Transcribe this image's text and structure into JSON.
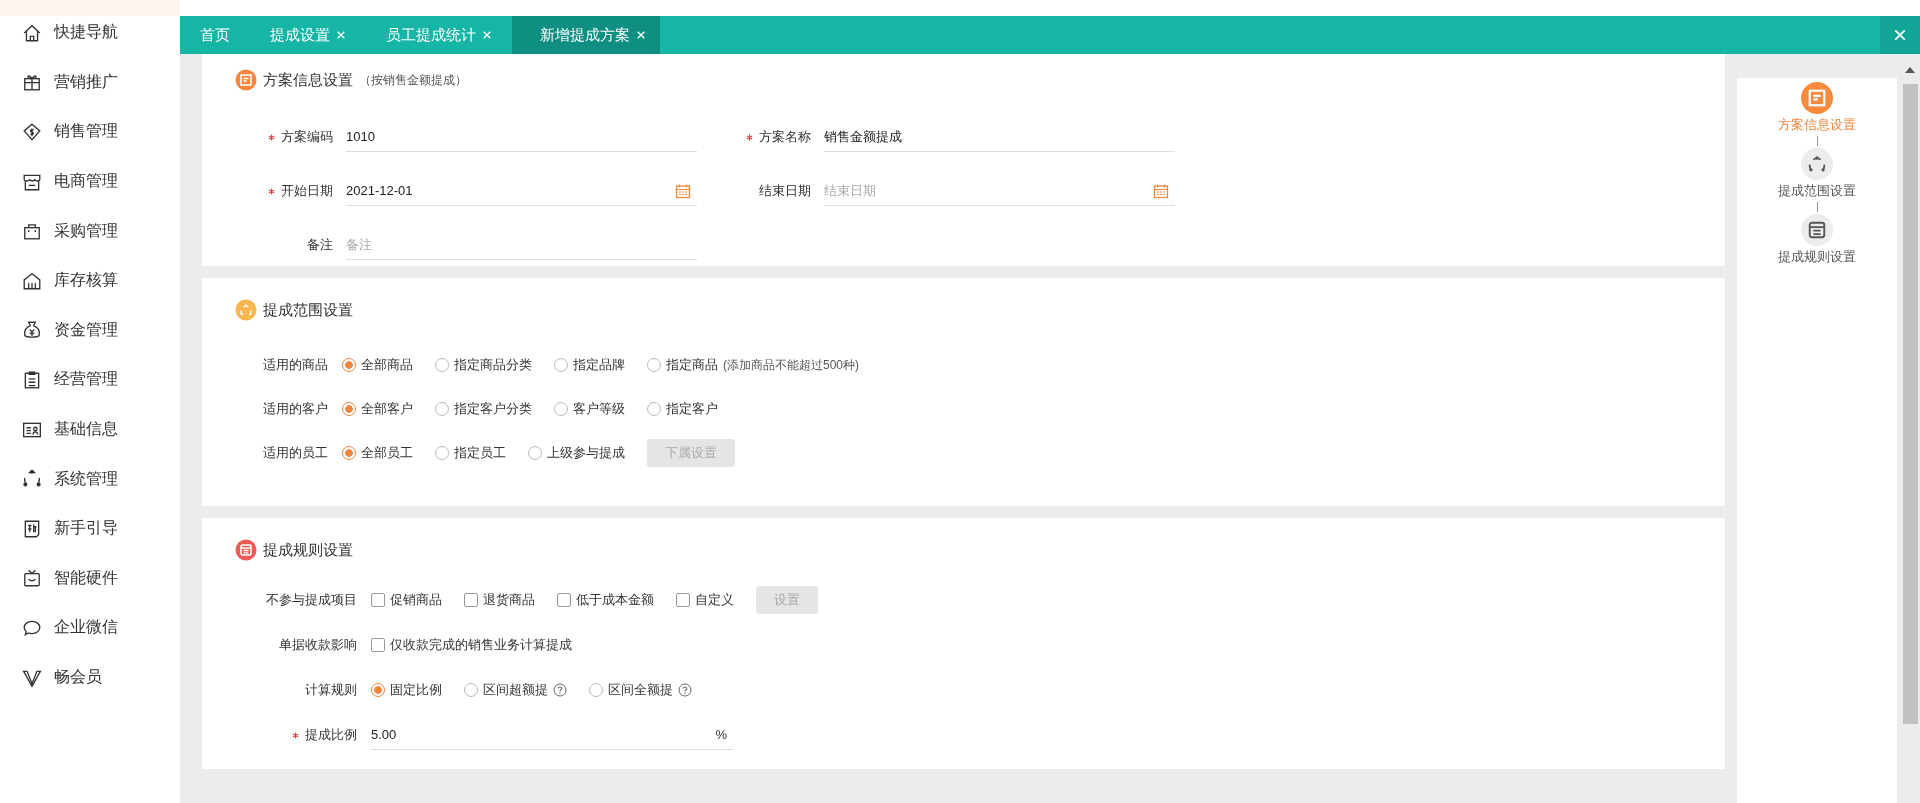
{
  "sidebar": {
    "items": [
      {
        "label": "快捷导航"
      },
      {
        "label": "营销推广"
      },
      {
        "label": "销售管理"
      },
      {
        "label": "电商管理"
      },
      {
        "label": "采购管理"
      },
      {
        "label": "库存核算"
      },
      {
        "label": "资金管理"
      },
      {
        "label": "经营管理"
      },
      {
        "label": "基础信息"
      },
      {
        "label": "系统管理"
      },
      {
        "label": "新手引导"
      },
      {
        "label": "智能硬件"
      },
      {
        "label": "企业微信"
      },
      {
        "label": "畅会员"
      }
    ]
  },
  "tabs": [
    {
      "label": "首页",
      "closable": false,
      "selected": false
    },
    {
      "label": "提成设置",
      "closable": true,
      "selected": false
    },
    {
      "label": "员工提成统计",
      "closable": true,
      "selected": false
    },
    {
      "label": "新增提成方案",
      "closable": true,
      "selected": true
    }
  ],
  "sections": [
    {
      "title": "方案信息设置",
      "subtitle": "（按销售金额提成）",
      "rows": [
        {
          "kind": "fields",
          "fields": [
            {
              "label": "方案编码",
              "required": true,
              "kind": "text",
              "value": "1010"
            },
            {
              "label": "方案名称",
              "required": true,
              "kind": "text",
              "value": "销售金额提成"
            }
          ]
        },
        {
          "kind": "fields",
          "fields": [
            {
              "label": "开始日期",
              "required": true,
              "kind": "date",
              "value": "2021-12-01"
            },
            {
              "label": "结束日期",
              "required": false,
              "kind": "date",
              "placeholder": "结束日期"
            }
          ]
        },
        {
          "kind": "fields",
          "fields": [
            {
              "label": "备注",
              "required": false,
              "kind": "text",
              "placeholder": "备注"
            }
          ]
        }
      ]
    },
    {
      "title": "提成范围设置",
      "rows": [
        {
          "kind": "radios",
          "label": "适用的商品",
          "options": [
            {
              "label": "全部商品",
              "selected": true
            },
            {
              "label": "指定商品分类",
              "selected": false
            },
            {
              "label": "指定品牌",
              "selected": false
            },
            {
              "label": "指定商品",
              "hint": "(添加商品不能超过500种)",
              "selected": false
            }
          ]
        },
        {
          "kind": "radios",
          "label": "适用的客户",
          "options": [
            {
              "label": "全部客户",
              "selected": true
            },
            {
              "label": "指定客户分类",
              "selected": false
            },
            {
              "label": "客户等级",
              "selected": false
            },
            {
              "label": "指定客户",
              "selected": false
            }
          ]
        },
        {
          "kind": "radios",
          "label": "适用的员工",
          "options": [
            {
              "label": "全部员工",
              "selected": true
            },
            {
              "label": "指定员工",
              "selected": false
            },
            {
              "label": "上级参与提成",
              "selected": false
            }
          ],
          "button": {
            "label": "下属设置",
            "disabled": true
          }
        }
      ]
    },
    {
      "title": "提成规则设置",
      "rows": [
        {
          "kind": "checks",
          "label": "不参与提成项目",
          "options": [
            {
              "label": "促销商品",
              "checked": false
            },
            {
              "label": "退货商品",
              "checked": false
            },
            {
              "label": "低于成本金额",
              "checked": false
            },
            {
              "label": "自定义",
              "checked": false
            }
          ],
          "button": {
            "label": "设置",
            "disabled": true
          }
        },
        {
          "kind": "checks",
          "label": "单据收款影响",
          "options": [
            {
              "label": "仅收款完成的销售业务计算提成",
              "checked": false
            }
          ]
        },
        {
          "kind": "radios",
          "label": "计算规则",
          "options": [
            {
              "label": "固定比例",
              "selected": true
            },
            {
              "label": "区间超额提",
              "help": true,
              "selected": false
            },
            {
              "label": "区间全额提",
              "help": true,
              "selected": false
            }
          ]
        },
        {
          "kind": "input",
          "label": "提成比例",
          "required": true,
          "value": "5.00",
          "unit": "%"
        }
      ]
    }
  ],
  "steps": [
    {
      "label": "方案信息设置",
      "selected": true
    },
    {
      "label": "提成范围设置",
      "selected": false
    },
    {
      "label": "提成规则设置",
      "selected": false
    }
  ]
}
